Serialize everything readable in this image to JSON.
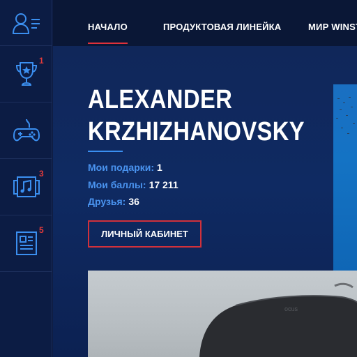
{
  "sidebar": {
    "items": [
      {
        "icon": "user-menu-icon",
        "badge": ""
      },
      {
        "icon": "trophy-icon",
        "badge": "1"
      },
      {
        "icon": "gamepad-icon",
        "badge": ""
      },
      {
        "icon": "music-icon",
        "badge": "3"
      },
      {
        "icon": "news-icon",
        "badge": "5"
      }
    ]
  },
  "nav": {
    "items": [
      {
        "label": "НАЧАЛО",
        "active": true
      },
      {
        "label": "ПРОДУКТОВАЯ ЛИНЕЙКА",
        "active": false
      },
      {
        "label": "МИР WINST",
        "active": false
      }
    ]
  },
  "profile": {
    "name_line1": "ALEXANDER",
    "name_line2": "KRZHIZHANOVSKY",
    "stats": [
      {
        "label": "Мои подарки:",
        "value": "1"
      },
      {
        "label": "Мои баллы:",
        "value": "17 211"
      },
      {
        "label": "Друзья:",
        "value": "36"
      }
    ],
    "cabinet_button": "ЛИЧНЫЙ КАБИНЕТ"
  },
  "product": {
    "brand_text": "ocus"
  },
  "colors": {
    "accent_red": "#e0313b",
    "accent_blue": "#4a94f0",
    "background": "#0b1a3f"
  }
}
